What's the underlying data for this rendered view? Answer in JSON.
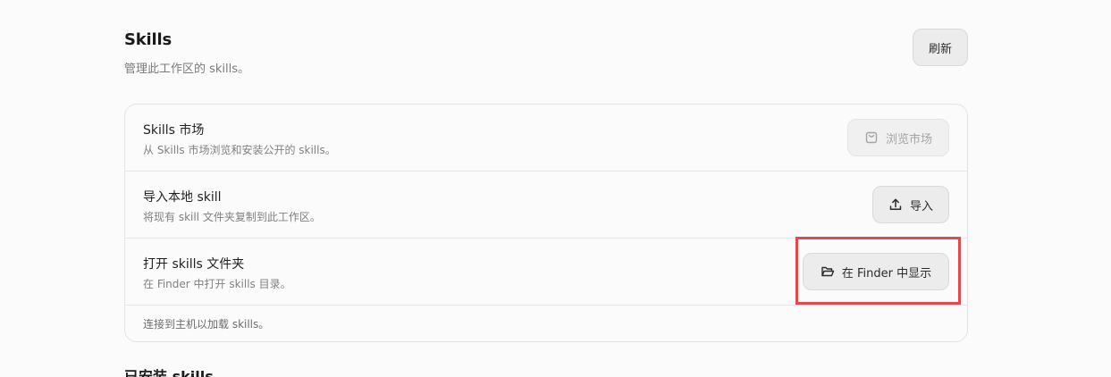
{
  "header": {
    "title": "Skills",
    "subtitle": "管理此工作区的 skills。",
    "refresh_label": "刷新"
  },
  "rows": [
    {
      "title": "Skills 市场",
      "description": "从 Skills 市场浏览和安装公开的 skills。",
      "action_label": "浏览市场",
      "action_icon": "shopping-bag-icon",
      "disabled": true
    },
    {
      "title": "导入本地 skill",
      "description": "将现有 skill 文件夹复制到此工作区。",
      "action_label": "导入",
      "action_icon": "upload-icon",
      "disabled": false
    },
    {
      "title": "打开 skills 文件夹",
      "description": "在 Finder 中打开 skills 目录。",
      "action_label": "在 Finder 中显示",
      "action_icon": "folder-open-icon",
      "disabled": false
    }
  ],
  "footer_note": "连接到主机以加载 skills。",
  "next_section_title": "已安装 skills",
  "colors": {
    "highlight": "#e5484d",
    "background": "#fbfbfb",
    "button_bg": "#ececec"
  }
}
